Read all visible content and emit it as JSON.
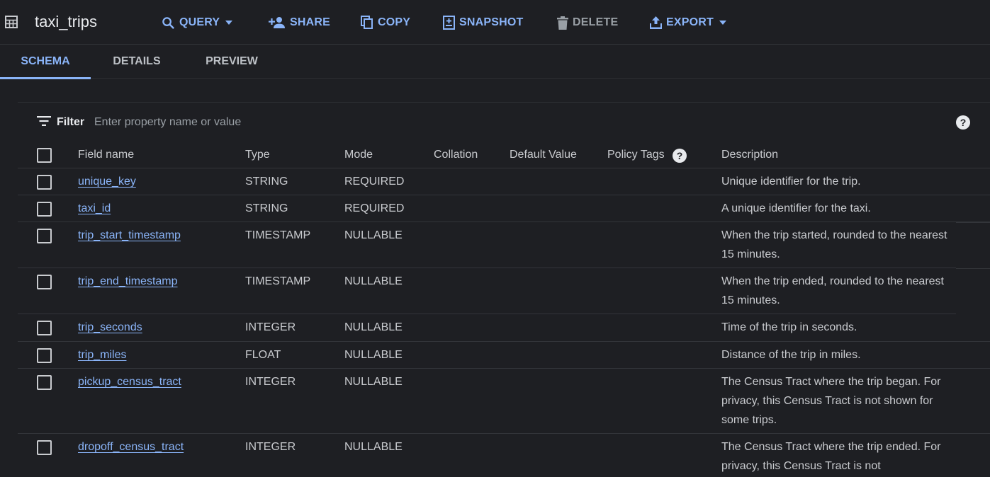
{
  "toolbar": {
    "title": "taxi_trips",
    "icon": "table-icon",
    "buttons": [
      {
        "label": "QUERY",
        "icon": "search-icon",
        "caret": true
      },
      {
        "label": "SHARE",
        "icon": "person-add-icon"
      },
      {
        "label": "COPY",
        "icon": "copy-icon"
      },
      {
        "label": "SNAPSHOT",
        "icon": "snapshot-icon"
      },
      {
        "label": "DELETE",
        "icon": "trash-icon",
        "disabled": true
      },
      {
        "label": "EXPORT",
        "icon": "upload-icon",
        "caret": true
      }
    ]
  },
  "tabs": [
    {
      "label": "SCHEMA",
      "active": true
    },
    {
      "label": "DETAILS",
      "active": false
    },
    {
      "label": "PREVIEW",
      "active": false
    }
  ],
  "filter": {
    "label": "Filter",
    "placeholder": "Enter property name or value",
    "value": ""
  },
  "columns": {
    "field_name": "Field name",
    "type": "Type",
    "mode": "Mode",
    "collation": "Collation",
    "default_value": "Default Value",
    "policy_tags": "Policy Tags",
    "description": "Description"
  },
  "rows": [
    {
      "name": "unique_key",
      "type": "STRING",
      "mode": "REQUIRED",
      "description": "Unique identifier for the trip."
    },
    {
      "name": "taxi_id",
      "type": "STRING",
      "mode": "REQUIRED",
      "description": "A unique identifier for the taxi."
    },
    {
      "name": "trip_start_timestamp",
      "type": "TIMESTAMP",
      "mode": "NULLABLE",
      "description": "When the trip started, rounded to the nearest 15 minutes."
    },
    {
      "name": "trip_end_timestamp",
      "type": "TIMESTAMP",
      "mode": "NULLABLE",
      "description": "When the trip ended, rounded to the nearest 15 minutes."
    },
    {
      "name": "trip_seconds",
      "type": "INTEGER",
      "mode": "NULLABLE",
      "description": "Time of the trip in seconds."
    },
    {
      "name": "trip_miles",
      "type": "FLOAT",
      "mode": "NULLABLE",
      "description": "Distance of the trip in miles."
    },
    {
      "name": "pickup_census_tract",
      "type": "INTEGER",
      "mode": "NULLABLE",
      "description": "The Census Tract where the trip began. For privacy, this Census Tract is not shown for some trips."
    },
    {
      "name": "dropoff_census_tract",
      "type": "INTEGER",
      "mode": "NULLABLE",
      "description": "The Census Tract where the trip ended. For privacy, this Census Tract is not"
    }
  ],
  "colors": {
    "background": "#1e1f23",
    "accent": "#8ab4f8",
    "text": "#c9cbcf"
  }
}
